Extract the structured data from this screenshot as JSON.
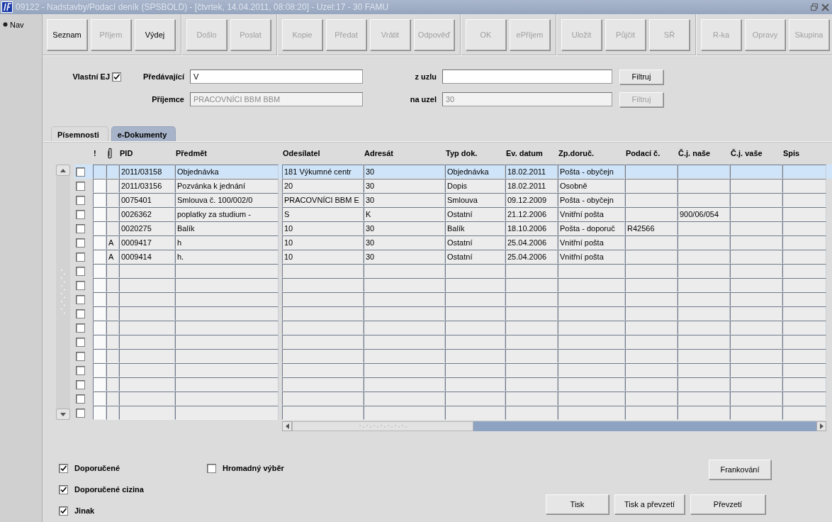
{
  "window": {
    "title": "09122 - Nadstavby/Podací deník (SPSBOLD) - [čtvrtek, 14.04.2011, 08:08:20] - Uzel:17 - 30 FAMU"
  },
  "nav": {
    "label": "Nav"
  },
  "toolbar": {
    "groups": [
      [
        {
          "label": "Seznam",
          "disabled": false
        },
        {
          "label": "Příjem",
          "disabled": true
        },
        {
          "label": "Výdej",
          "disabled": false
        }
      ],
      [
        {
          "label": "Došlo",
          "disabled": true
        },
        {
          "label": "Poslat",
          "disabled": true
        }
      ],
      [
        {
          "label": "Kopie",
          "disabled": true
        },
        {
          "label": "Předat",
          "disabled": true
        },
        {
          "label": "Vrátit",
          "disabled": true
        },
        {
          "label": "Odpověď",
          "disabled": true
        }
      ],
      [
        {
          "label": "OK",
          "disabled": true
        },
        {
          "label": "ePříjem",
          "disabled": true
        }
      ],
      [
        {
          "label": "Uložit",
          "disabled": true
        },
        {
          "label": "Půjčit",
          "disabled": true
        },
        {
          "label": "SŘ",
          "disabled": true
        }
      ],
      [
        {
          "label": "R-ka",
          "disabled": true
        },
        {
          "label": "Opravy",
          "disabled": true
        },
        {
          "label": "Skupina",
          "disabled": true
        }
      ]
    ]
  },
  "filter": {
    "own_unit": {
      "label": "Vlastní EJ",
      "checked": true
    },
    "rows": [
      [
        {
          "label": "Předávající",
          "value": "V",
          "disabled": false
        },
        {
          "label": "z uzlu",
          "disabled": false,
          "button": {
            "label": "Filtruj",
            "disabled": false
          }
        }
      ],
      [
        {
          "label": "Příjemce",
          "value": "PRACOVNÍCI BBM BBM",
          "disabled": true
        },
        {
          "label": "na uzel",
          "value": "30",
          "disabled": true,
          "button": {
            "label": "Filtruj",
            "disabled": true
          }
        }
      ]
    ]
  },
  "tabs": [
    {
      "label": "Písemnosti",
      "selected": true
    },
    {
      "label": "e-Dokumenty",
      "selected": false
    }
  ],
  "table": {
    "columns": [
      {
        "kind": "text",
        "label": "!"
      },
      {
        "kind": "attachment"
      },
      {
        "kind": "text",
        "label": "PID"
      },
      {
        "kind": "text",
        "label": "Předmět"
      },
      {
        "kind": "text",
        "label": "Odesílatel"
      },
      {
        "kind": "text",
        "label": "Adresát"
      },
      {
        "kind": "text",
        "label": "Typ dok."
      },
      {
        "kind": "text",
        "label": "Ev. datum"
      },
      {
        "kind": "text",
        "label": "Zp.doruč."
      },
      {
        "kind": "text",
        "label": "Podací č."
      },
      {
        "kind": "text",
        "label": "Č.j. naše"
      },
      {
        "kind": "text",
        "label": "Č.j. vaše"
      },
      {
        "kind": "text",
        "label": "Spis"
      }
    ],
    "rows": [
      {
        "selected": true,
        "checked": false,
        "cells": [
          null,
          null,
          "2011/03158",
          "Objednávka",
          "181 Výkumné centr",
          "30",
          "Objednávka",
          "18.02.2011",
          "Pošta - obyčejn",
          null,
          null,
          null,
          null
        ]
      },
      {
        "selected": false,
        "checked": false,
        "cells": [
          null,
          null,
          "2011/03156",
          "Pozvánka k jednání",
          "20",
          "30",
          "Dopis",
          "18.02.2011",
          "Osobně",
          null,
          null,
          null,
          null
        ]
      },
      {
        "selected": false,
        "checked": false,
        "cells": [
          null,
          null,
          "0075401",
          "Smlouva č. 100/002/0",
          "PRACOVNÍCI BBM E",
          "30",
          "Smlouva",
          "09.12.2009",
          "Pošta - obyčejn",
          null,
          null,
          null,
          null
        ]
      },
      {
        "selected": false,
        "checked": false,
        "cells": [
          null,
          null,
          "0026362",
          "poplatky za studium -",
          "S",
          "K",
          "Ostatní",
          "21.12.2006",
          "Vnitřní pošta",
          null,
          "900/06/054",
          null,
          null
        ]
      },
      {
        "selected": false,
        "checked": false,
        "cells": [
          null,
          null,
          "0020275",
          "Balík",
          "10",
          "30",
          "Balík",
          "18.10.2006",
          "Pošta - doporuč",
          "R42566",
          null,
          null,
          null
        ]
      },
      {
        "selected": false,
        "checked": false,
        "cells": [
          null,
          "A",
          "0009417",
          "h",
          "10",
          "30",
          "Ostatní",
          "25.04.2006",
          "Vnitřní pošta",
          null,
          null,
          null,
          null
        ]
      },
      {
        "selected": false,
        "checked": false,
        "cells": [
          null,
          "A",
          "0009414",
          "h.",
          "10",
          "30",
          "Ostatní",
          "25.04.2006",
          "Vnitřní pošta",
          null,
          null,
          null,
          null
        ]
      },
      {
        "selected": false,
        "checked": false
      },
      {
        "selected": false,
        "checked": false
      },
      {
        "selected": false,
        "checked": false
      },
      {
        "selected": false,
        "checked": false
      },
      {
        "selected": false,
        "checked": false
      },
      {
        "selected": false,
        "checked": false
      },
      {
        "selected": false,
        "checked": false
      },
      {
        "selected": false,
        "checked": false
      },
      {
        "selected": false,
        "checked": false
      },
      {
        "selected": false,
        "checked": false
      },
      {
        "selected": false,
        "checked": false
      }
    ]
  },
  "options": [
    {
      "label": "Doporučené",
      "checked": true
    },
    {
      "label": "Doporučené cizina",
      "checked": true
    },
    {
      "label": "Jinak",
      "checked": true
    }
  ],
  "bulk_select": {
    "label": "Hromadný výběr",
    "checked": false
  },
  "actions": [
    "Frankování",
    "Tisk",
    "Tisk a převzetí",
    "Převzetí"
  ]
}
